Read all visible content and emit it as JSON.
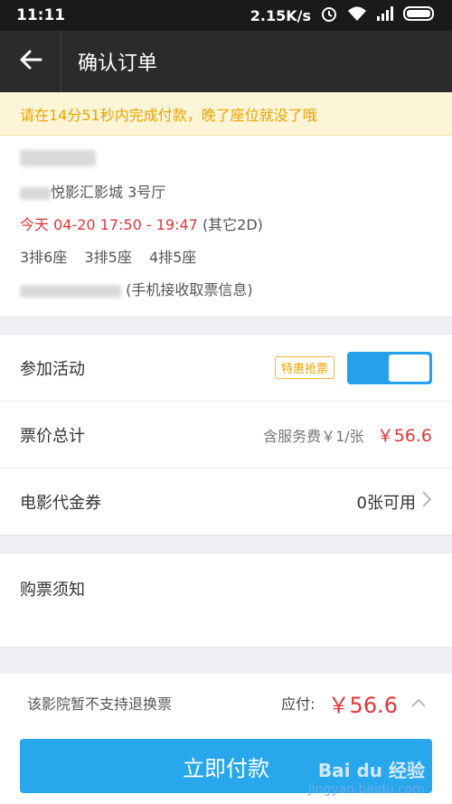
{
  "status_bar": {
    "time": "11:11",
    "speed": "2.15K/s"
  },
  "header": {
    "title": "确认订单"
  },
  "notice": {
    "text": "请在14分51秒内完成付款，晚了座位就没了哦"
  },
  "order": {
    "cinema_suffix": "悦影汇影城 3号厅",
    "showtime": "今天 04-20 17:50 - 19:47",
    "format": "(其它2D)",
    "seats": [
      "3排6座",
      "3排5座",
      "4排5座"
    ],
    "phone_note": "(手机接收取票信息)"
  },
  "activity": {
    "label": "参加活动",
    "badge": "特惠抢票",
    "toggle_on": true
  },
  "total": {
    "label": "票价总计",
    "fee_note": "含服务费￥1/张",
    "price": "￥56.6"
  },
  "voucher": {
    "label": "电影代金券",
    "value": "0张可用"
  },
  "notes": {
    "title": "购票须知"
  },
  "pay": {
    "refund_note": "该影院暂不支持退换票",
    "due_label": "应付:",
    "due_amount": "￥56.6",
    "button": "立即付款"
  },
  "watermark": {
    "brand": "Bai du 经验",
    "url": "jingyan.baidu.com"
  },
  "colors": {
    "accent_blue": "#28a7ec",
    "price_red": "#e0363b",
    "notice_orange": "#f0a100"
  }
}
